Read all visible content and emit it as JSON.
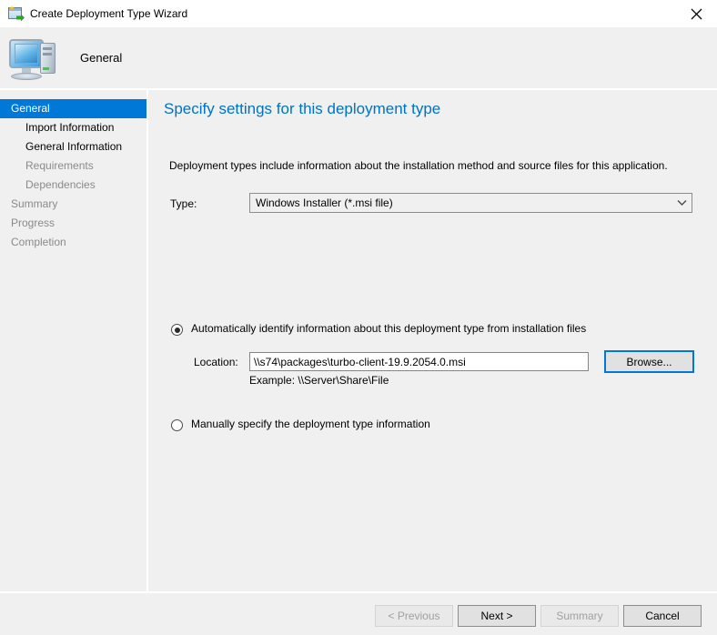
{
  "window": {
    "title": "Create Deployment Type Wizard",
    "icon": "deployment-type-wizard-icon",
    "close_label": "✕"
  },
  "header": {
    "title": "General",
    "icon": "computer-icon"
  },
  "sidebar": {
    "items": [
      {
        "label": "General",
        "level": 0,
        "state": "selected"
      },
      {
        "label": "Import Information",
        "level": 1,
        "state": "active"
      },
      {
        "label": "General Information",
        "level": 1,
        "state": "active"
      },
      {
        "label": "Requirements",
        "level": 1,
        "state": "disabled"
      },
      {
        "label": "Dependencies",
        "level": 1,
        "state": "disabled"
      },
      {
        "label": "Summary",
        "level": 0,
        "state": "disabled"
      },
      {
        "label": "Progress",
        "level": 0,
        "state": "disabled"
      },
      {
        "label": "Completion",
        "level": 0,
        "state": "disabled"
      }
    ]
  },
  "content": {
    "page_title": "Specify settings for this deployment type",
    "intro": "Deployment types include information about the installation method and source files for this application.",
    "type": {
      "label": "Type:",
      "value": "Windows Installer (*.msi file)",
      "arrow_icon": "chevron-down-icon"
    },
    "option_auto": {
      "label": "Automatically identify information about this deployment type from installation files",
      "selected": true
    },
    "location": {
      "label": "Location:",
      "value": "\\\\s74\\packages\\turbo-client-19.9.2054.0.msi",
      "placeholder": "",
      "browse_label": "Browse...",
      "example": "Example: \\\\Server\\Share\\File"
    },
    "option_manual": {
      "label": "Manually specify the deployment type information",
      "selected": false
    }
  },
  "footer": {
    "previous_label": "< Previous",
    "next_label": "Next >",
    "summary_label": "Summary",
    "cancel_label": "Cancel"
  },
  "colors": {
    "accent": "#0078d7",
    "title_blue": "#0072c6",
    "chrome": "#f0f0f0",
    "disabled_text": "#8a8a8a"
  }
}
